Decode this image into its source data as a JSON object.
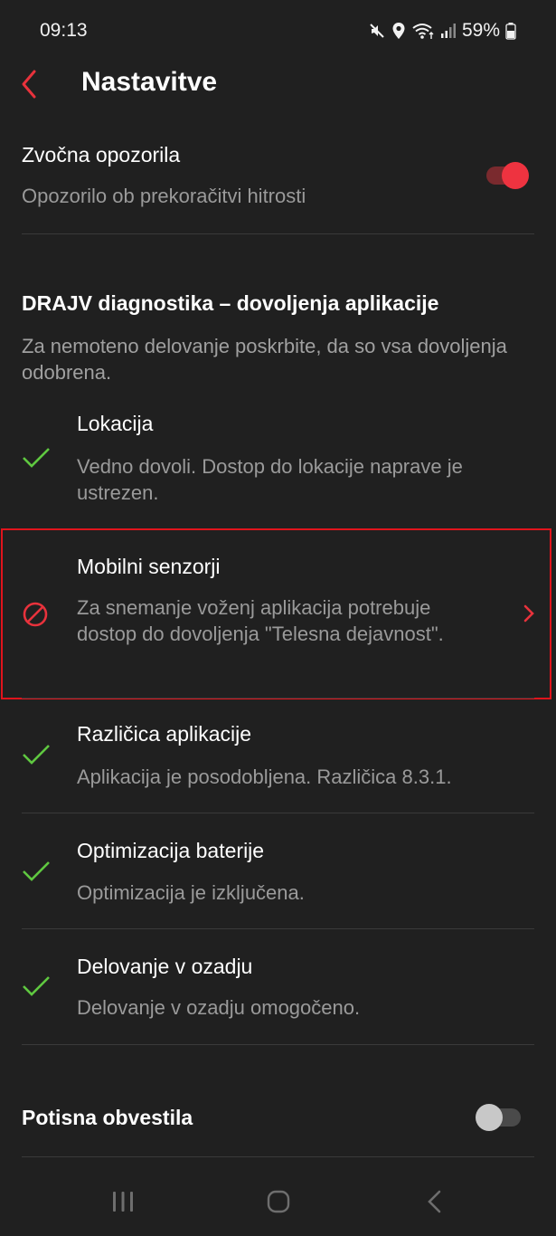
{
  "status_bar": {
    "time": "09:13",
    "battery": "59%"
  },
  "header": {
    "title": "Nastavitve"
  },
  "sound_alerts": {
    "title": "Zvočna opozorila",
    "subtitle": "Opozorilo ob prekoračitvi hitrosti",
    "enabled": true
  },
  "diagnostics": {
    "title": "DRAJV diagnostika – dovoljenja aplikacije",
    "description": "Za nemoteno delovanje poskrbite, da so vsa dovoljenja odobrena.",
    "items": [
      {
        "title": "Lokacija",
        "description": "Vedno dovoli. Dostop do lokacije naprave je ustrezen.",
        "status": "ok"
      },
      {
        "title": "Mobilni senzorji",
        "description": "Za snemanje voženj aplikacija potrebuje dostop do dovoljenja \"Telesna dejavnost\".",
        "status": "denied"
      },
      {
        "title": "Različica aplikacije",
        "description": "Aplikacija je posodobljena. Različica 8.3.1.",
        "status": "ok"
      },
      {
        "title": "Optimizacija baterije",
        "description": "Optimizacija je izključena.",
        "status": "ok"
      },
      {
        "title": "Delovanje v ozadju",
        "description": "Delovanje v ozadju omogočeno.",
        "status": "ok"
      }
    ]
  },
  "push_notifications": {
    "title": "Potisna obvestila",
    "enabled": false
  },
  "colors": {
    "accent": "#e8323c",
    "check": "#5fc840",
    "background": "#202020"
  },
  "icons": {
    "back": "chevron-left-icon",
    "ok": "checkmark-icon",
    "denied": "prohibited-icon",
    "navigate": "chevron-right-icon"
  }
}
